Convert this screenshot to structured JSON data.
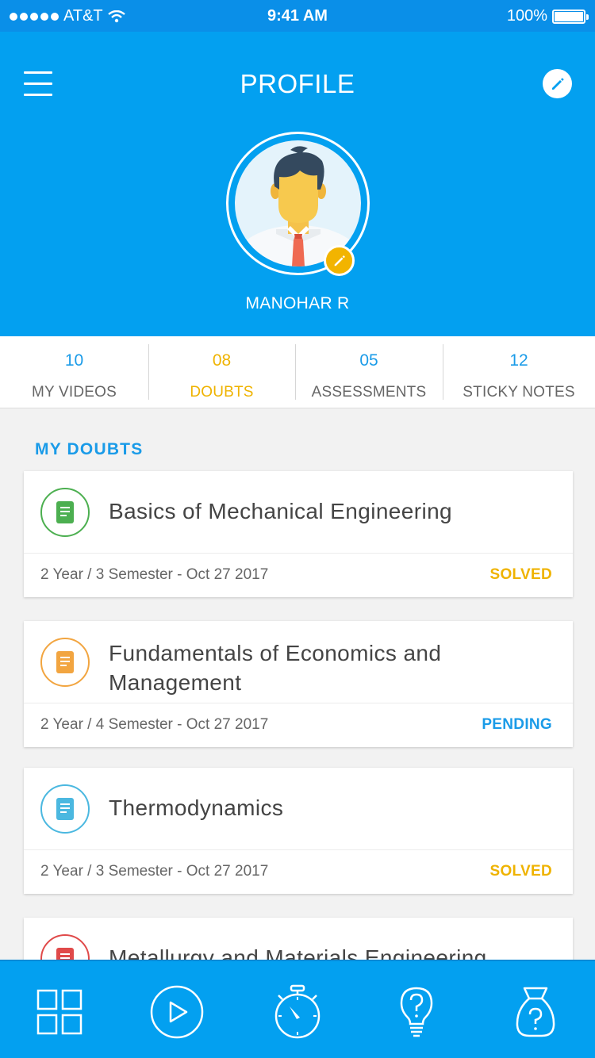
{
  "status_bar": {
    "carrier": "AT&T",
    "time": "9:41 AM",
    "battery": "100%"
  },
  "header": {
    "title": "PROFILE",
    "user_name": "MANOHAR R"
  },
  "stats": [
    {
      "value": "10",
      "label": "MY VIDEOS"
    },
    {
      "value": "08",
      "label": "DOUBTS"
    },
    {
      "value": "05",
      "label": "ASSESSMENTS"
    },
    {
      "value": "12",
      "label": "STICKY NOTES"
    }
  ],
  "active_stat": "DOUBTS",
  "section": {
    "title": "MY DOUBTS"
  },
  "doubts": [
    {
      "title": "Basics of Mechanical Engineering",
      "subtitle": "2 Year / 3 Semester - Oct 27 2017",
      "status": "SOLVED",
      "icon_color": "#4caf50"
    },
    {
      "title": "Fundamentals of Economics and Management",
      "subtitle": "2 Year / 4 Semester - Oct 27 2017",
      "status": "PENDING",
      "icon_color": "#f2a540"
    },
    {
      "title": "Thermodynamics",
      "subtitle": "2 Year / 3 Semester - Oct 27 2017",
      "status": "SOLVED",
      "icon_color": "#4bb8e0"
    },
    {
      "title": "Metallurgy and Materials Engineering",
      "icon_color": "#e04a4a"
    }
  ],
  "status_colors": {
    "SOLVED": "#efb300",
    "PENDING": "#1a9be8"
  },
  "colors": {
    "primary": "#03a0f0",
    "accent": "#efb300"
  },
  "tabbar": [
    {
      "icon": "grid-icon"
    },
    {
      "icon": "play-circle-icon"
    },
    {
      "icon": "stopwatch-icon"
    },
    {
      "icon": "lightbulb-question-icon"
    },
    {
      "icon": "bag-question-icon"
    }
  ]
}
